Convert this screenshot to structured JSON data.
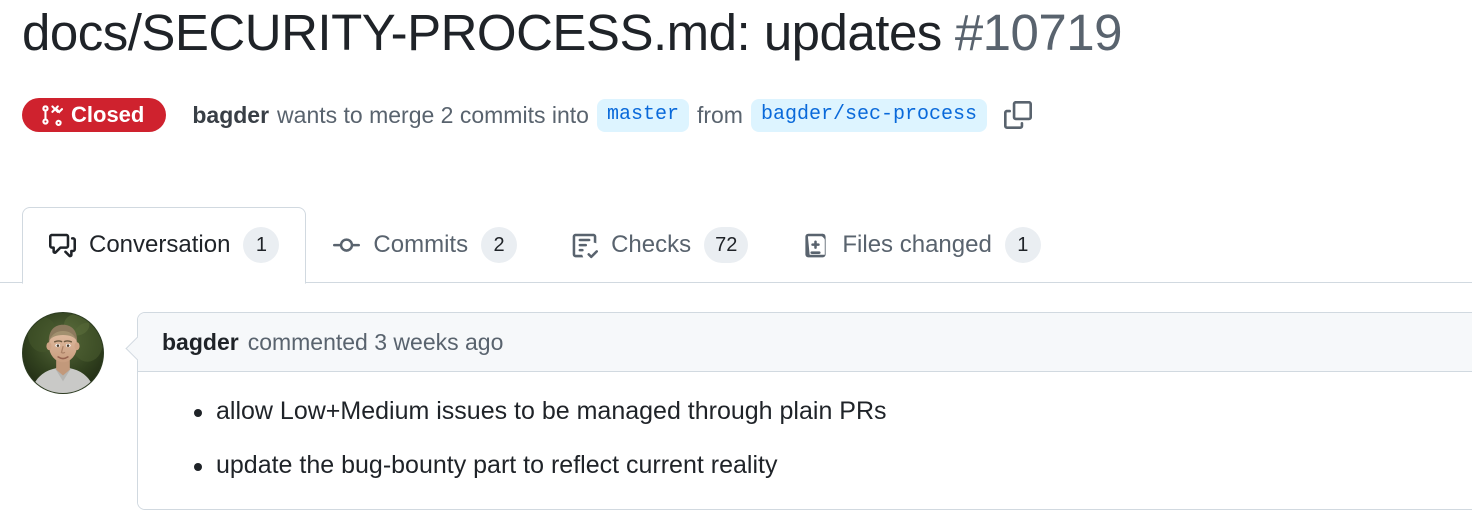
{
  "pull_request": {
    "title": "docs/SECURITY-PROCESS.md: updates",
    "number": "#10719",
    "state": {
      "label": "Closed",
      "icon": "git-pull-request-closed-icon",
      "color": "#cf222e"
    },
    "merge_info": {
      "author": "bagder",
      "wants_text": "wants to merge 2 commits into",
      "base_branch": "master",
      "from_text": "from",
      "head_branch": "bagder/sec-process",
      "copy_icon": "copy-icon"
    }
  },
  "tabs": [
    {
      "label": "Conversation",
      "count": "1",
      "icon": "comment-discussion-icon",
      "active": true
    },
    {
      "label": "Commits",
      "count": "2",
      "icon": "git-commit-icon",
      "active": false
    },
    {
      "label": "Checks",
      "count": "72",
      "icon": "checklist-icon",
      "active": false
    },
    {
      "label": "Files changed",
      "count": "1",
      "icon": "file-diff-icon",
      "active": false
    }
  ],
  "comment": {
    "avatar_alt": "bagder-avatar",
    "author": "bagder",
    "meta": "commented 3 weeks ago",
    "body_items": [
      "allow Low+Medium issues to be managed through plain PRs",
      "update the bug-bounty part to reflect current reality"
    ]
  },
  "colors": {
    "closed_red": "#cf222e",
    "branch_chip_bg": "#ddf4ff",
    "branch_chip_text": "#0969da",
    "border": "#d1d9e0",
    "muted_text": "#59636e",
    "counter_bg": "#eaeef2",
    "header_bg": "#f6f8fa"
  }
}
